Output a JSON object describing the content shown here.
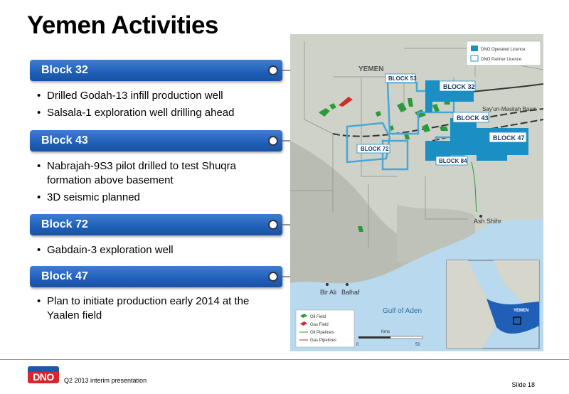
{
  "slide": {
    "title": "Yemen Activities",
    "footer_text": "Q2 2013 interim presentation",
    "slide_number": "Slide 18",
    "logo_text": "DNO"
  },
  "blocks": [
    {
      "label": "Block 32",
      "bullets": [
        "Drilled Godah-13 infill production well",
        "Salsala-1 exploration well drilling ahead"
      ]
    },
    {
      "label": "Block 43",
      "bullets": [
        "Nabrajah-9S3 pilot drilled to test Shuqra formation above basement",
        "3D seismic planned"
      ]
    },
    {
      "label": "Block 72",
      "bullets": [
        "Gabdain-3 exploration well"
      ]
    },
    {
      "label": "Block 47",
      "bullets": [
        "Plan to initiate production early 2014 at the Yaalen field"
      ]
    }
  ],
  "map": {
    "country_label": "YEMEN",
    "basin_label": "Say'un-Masilah Basin",
    "block_labels": [
      "BLOCK 53",
      "BLOCK 32",
      "BLOCK 43",
      "BLOCK 47",
      "BLOCK 72",
      "BLOCK 84"
    ],
    "places": [
      "Ash Shihr",
      "Bir Ali",
      "Balhaf",
      "Gulf of Aden"
    ],
    "licence_legend": [
      "DNO Operated Licence",
      "DNO Partner Licence"
    ],
    "feature_legend": [
      "Oil Field",
      "Gas Field",
      "Oil Pipelines",
      "Gas Pipelines"
    ],
    "scale_labels": [
      "0",
      "Kms",
      "50"
    ],
    "inset_label": "YEMEN",
    "colors": {
      "operated": "#1b8fc4",
      "partner_outline": "#4aa6d6",
      "oil_field": "#2a9a3a",
      "gas_field": "#d12a2a",
      "sea": "#b9d9ee",
      "land": "#cfd2c8"
    }
  }
}
